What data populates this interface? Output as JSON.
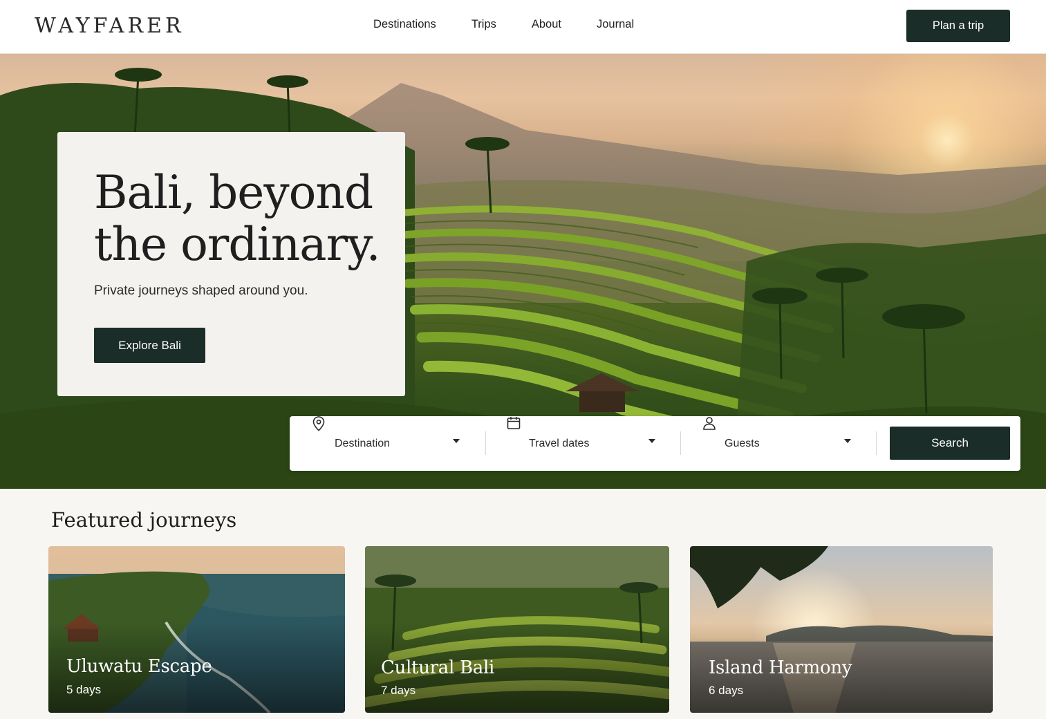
{
  "brand": {
    "logo": "WAYFARER"
  },
  "nav": {
    "items": [
      {
        "label": "Destinations"
      },
      {
        "label": "Trips"
      },
      {
        "label": "About"
      },
      {
        "label": "Journal"
      }
    ]
  },
  "header": {
    "cta_label": "Plan a trip"
  },
  "hero": {
    "title_line1": "Bali, beyond",
    "title_line2": "the ordinary.",
    "subtitle": "Private journeys shaped around you.",
    "cta_label": "Explore Bali"
  },
  "search": {
    "destination": {
      "label": "Destination",
      "icon": "map-pin-icon"
    },
    "dates": {
      "label": "Travel dates",
      "icon": "calendar-icon"
    },
    "guests": {
      "label": "Guests",
      "icon": "user-icon"
    },
    "button_label": "Search"
  },
  "featured": {
    "title": "Featured journeys",
    "cards": [
      {
        "title": "Uluwatu Escape",
        "days": "5 days"
      },
      {
        "title": "Cultural Bali",
        "days": "7 days"
      },
      {
        "title": "Island Harmony",
        "days": "6 days"
      }
    ]
  },
  "colors": {
    "primary": "#1b2d28",
    "background": "#f8f6f2",
    "card": "#f4f2ee"
  }
}
